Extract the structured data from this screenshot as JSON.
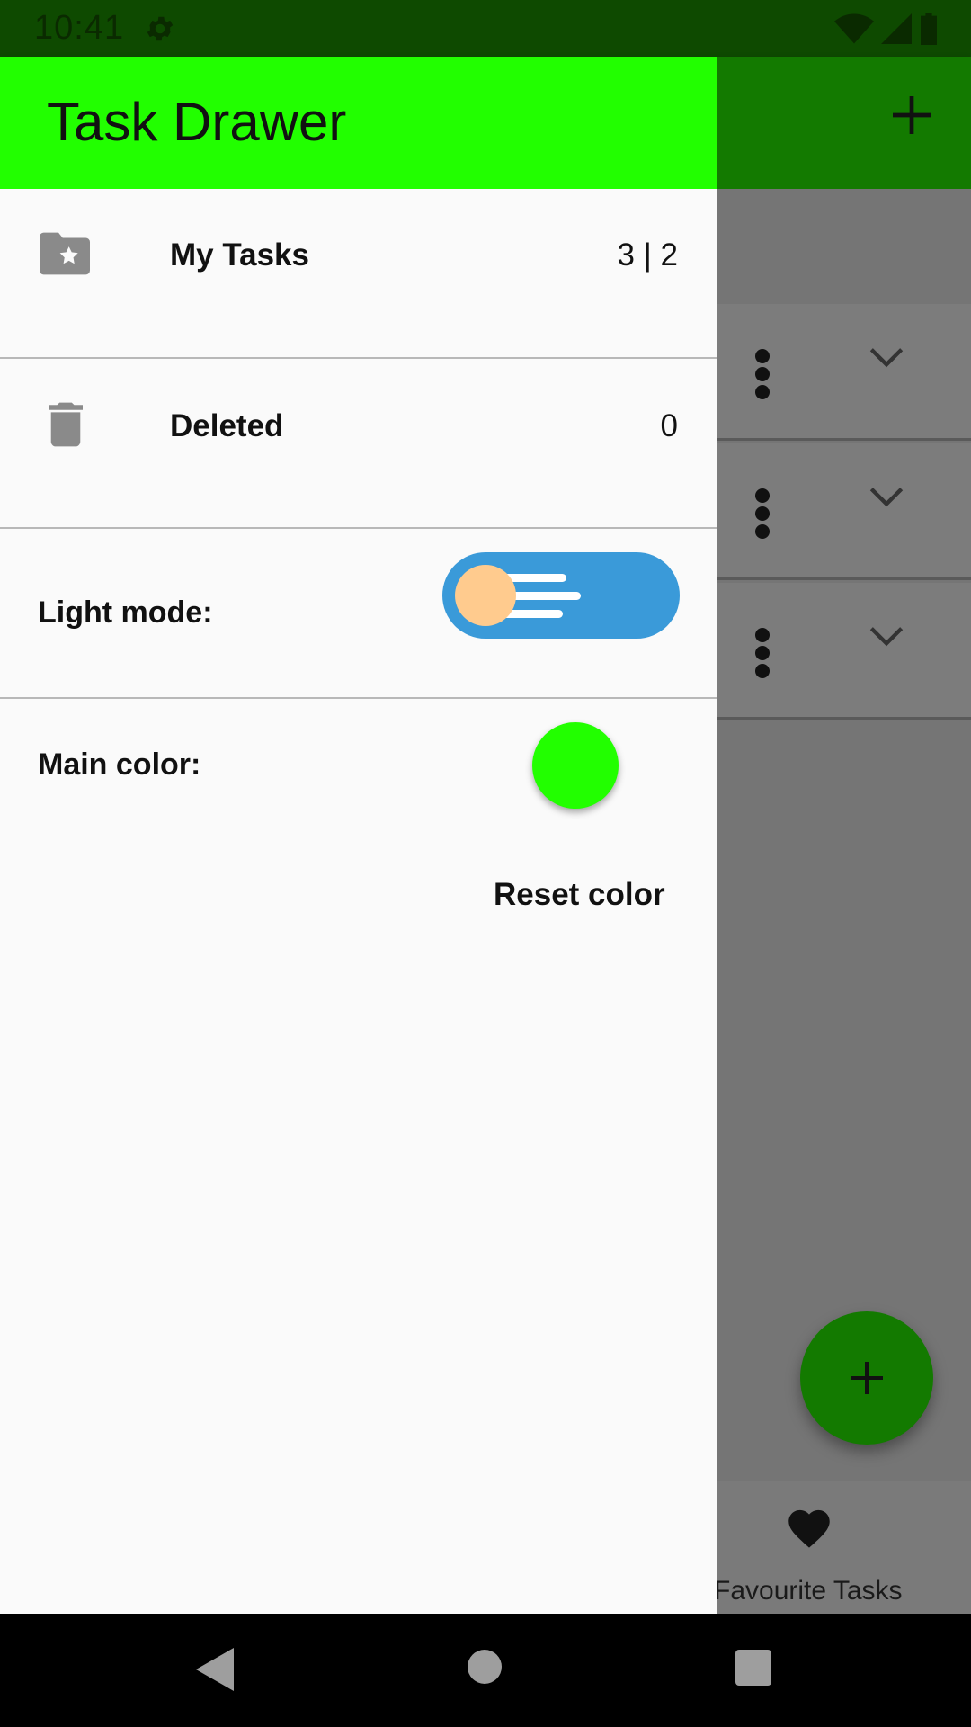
{
  "status_bar": {
    "time": "10:41"
  },
  "drawer": {
    "title": "Task Drawer",
    "items": [
      {
        "label": "My Tasks",
        "count": "3 | 2",
        "icon": "folder-star-icon"
      },
      {
        "label": "Deleted",
        "count": "0",
        "icon": "trash-icon"
      }
    ],
    "light_mode_label": "Light mode:",
    "main_color_label": "Main color:",
    "main_color": "#22ff00",
    "reset_color_label": "Reset color"
  },
  "background": {
    "bottom_nav_label": "Favourite Tasks",
    "app_bar_color": "#137a00"
  }
}
